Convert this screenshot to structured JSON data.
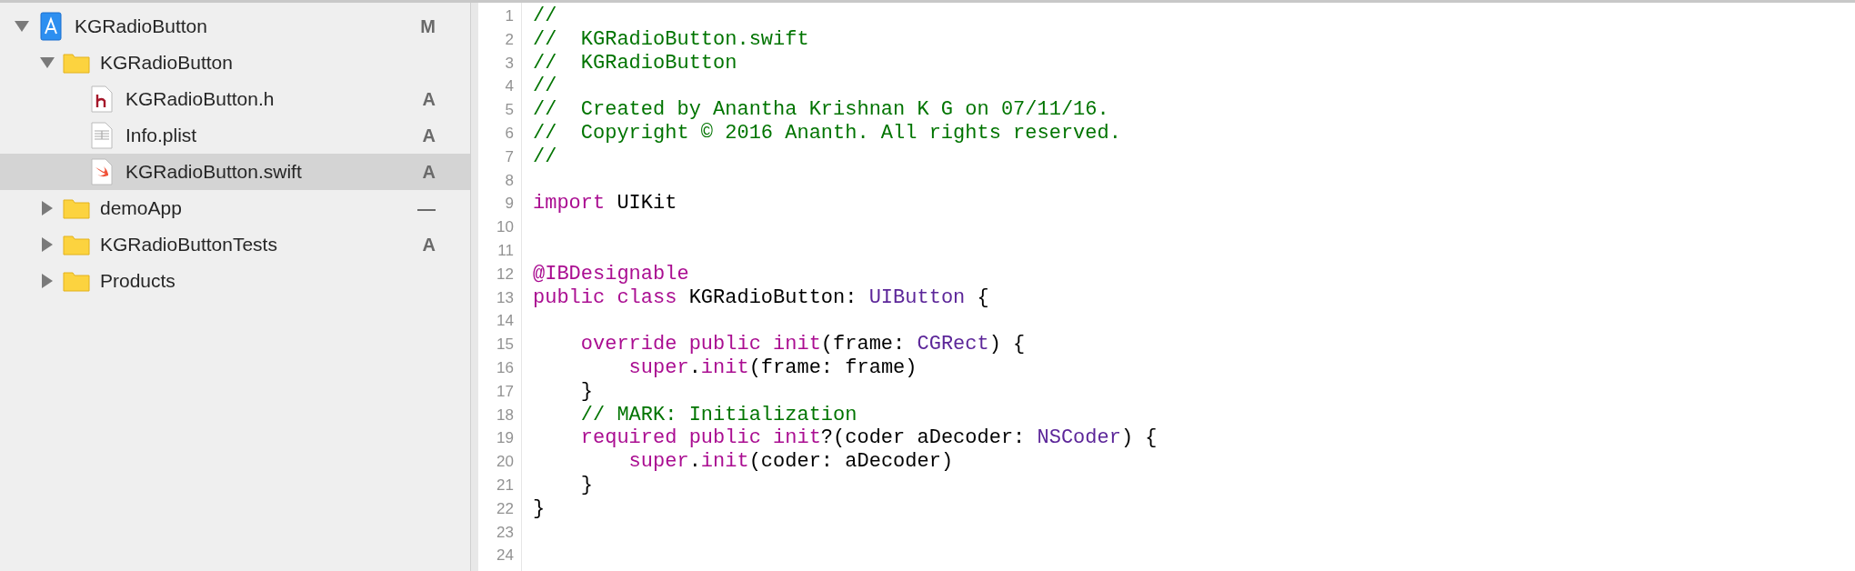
{
  "navigator": {
    "items": [
      {
        "name": "KGRadioButton",
        "kind": "project",
        "status": "M",
        "expanded": true,
        "selected": false,
        "children": [
          {
            "name": "KGRadioButton",
            "kind": "folder",
            "expanded": true,
            "selected": false,
            "children": [
              {
                "name": "KGRadioButton.h",
                "kind": "header",
                "status": "A",
                "selected": false
              },
              {
                "name": "Info.plist",
                "kind": "plist",
                "status": "A",
                "selected": false
              },
              {
                "name": "KGRadioButton.swift",
                "kind": "swift",
                "status": "A",
                "selected": true
              }
            ]
          },
          {
            "name": "demoApp",
            "kind": "folder",
            "status": "—",
            "expanded": false,
            "selected": false
          },
          {
            "name": "KGRadioButtonTests",
            "kind": "folder",
            "status": "A",
            "expanded": false,
            "selected": false
          },
          {
            "name": "Products",
            "kind": "folder",
            "expanded": false,
            "selected": false
          }
        ]
      }
    ]
  },
  "editor": {
    "lines": [
      {
        "number": "1",
        "tokens": [
          {
            "kind": "comment",
            "text": "//"
          }
        ]
      },
      {
        "number": "2",
        "tokens": [
          {
            "kind": "comment",
            "text": "//  KGRadioButton.swift"
          }
        ]
      },
      {
        "number": "3",
        "tokens": [
          {
            "kind": "comment",
            "text": "//  KGRadioButton"
          }
        ]
      },
      {
        "number": "4",
        "tokens": [
          {
            "kind": "comment",
            "text": "//"
          }
        ]
      },
      {
        "number": "5",
        "tokens": [
          {
            "kind": "comment",
            "text": "//  Created by Anantha Krishnan K G on 07/11/16."
          }
        ]
      },
      {
        "number": "6",
        "tokens": [
          {
            "kind": "comment",
            "text": "//  Copyright © 2016 Ananth. All rights reserved."
          }
        ]
      },
      {
        "number": "7",
        "tokens": [
          {
            "kind": "comment",
            "text": "//"
          }
        ]
      },
      {
        "number": "8"
      },
      {
        "number": "9",
        "tokens": [
          {
            "kind": "keyword",
            "text": "import"
          },
          {
            "kind": "plain",
            "text": " UIKit"
          }
        ]
      },
      {
        "number": "10"
      },
      {
        "number": "11"
      },
      {
        "number": "12",
        "tokens": [
          {
            "kind": "keyword",
            "text": "@IBDesignable"
          }
        ]
      },
      {
        "number": "13",
        "tokens": [
          {
            "kind": "keyword",
            "text": "public class"
          },
          {
            "kind": "plain",
            "text": " KGRadioButton: "
          },
          {
            "kind": "type",
            "text": "UIButton"
          },
          {
            "kind": "plain",
            "text": " {"
          }
        ]
      },
      {
        "number": "14"
      },
      {
        "number": "15",
        "tokens": [
          {
            "kind": "keyword",
            "text": "    override public init"
          },
          {
            "kind": "plain",
            "text": "(frame: "
          },
          {
            "kind": "type",
            "text": "CGRect"
          },
          {
            "kind": "plain",
            "text": ") {"
          }
        ]
      },
      {
        "number": "16",
        "tokens": [
          {
            "kind": "keyword",
            "text": "        super"
          },
          {
            "kind": "plain",
            "text": "."
          },
          {
            "kind": "keyword",
            "text": "init"
          },
          {
            "kind": "plain",
            "text": "(frame: frame)"
          }
        ]
      },
      {
        "number": "17",
        "tokens": [
          {
            "kind": "plain",
            "text": "    }"
          }
        ]
      },
      {
        "number": "18",
        "tokens": [
          {
            "kind": "comment",
            "text": "    // MARK: Initialization"
          }
        ]
      },
      {
        "number": "19",
        "tokens": [
          {
            "kind": "keyword",
            "text": "    required public init"
          },
          {
            "kind": "plain",
            "text": "?(coder aDecoder: "
          },
          {
            "kind": "type",
            "text": "NSCoder"
          },
          {
            "kind": "plain",
            "text": ") {"
          }
        ]
      },
      {
        "number": "20",
        "tokens": [
          {
            "kind": "keyword",
            "text": "        super"
          },
          {
            "kind": "plain",
            "text": "."
          },
          {
            "kind": "keyword",
            "text": "init"
          },
          {
            "kind": "plain",
            "text": "(coder: aDecoder)"
          }
        ]
      },
      {
        "number": "21",
        "tokens": [
          {
            "kind": "plain",
            "text": "    }"
          }
        ]
      },
      {
        "number": "22",
        "tokens": [
          {
            "kind": "plain",
            "text": "}"
          }
        ]
      },
      {
        "number": "23"
      },
      {
        "number": "24"
      }
    ]
  }
}
